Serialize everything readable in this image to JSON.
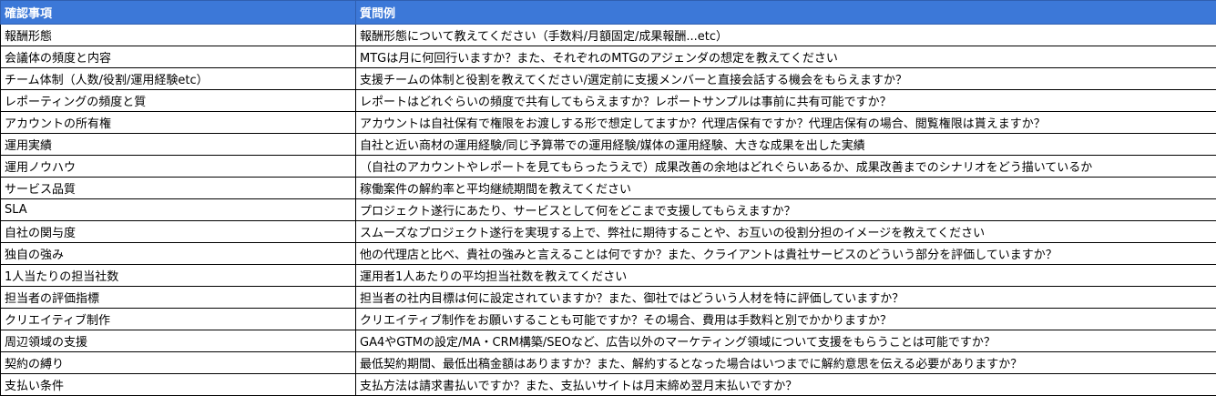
{
  "colors": {
    "header_bg": "#3c78d8",
    "header_text": "#ffffff",
    "border": "#000000"
  },
  "table": {
    "headers": [
      "確認事項",
      "質問例"
    ],
    "rows": [
      [
        "報酬形態",
        "報酬形態について教えてください（手数料/月額固定/成果報酬...etc）"
      ],
      [
        "会議体の頻度と内容",
        "MTGは月に何回行いますか？また、それぞれのMTGのアジェンダの想定を教えてください"
      ],
      [
        "チーム体制（人数/役割/運用経験etc）",
        "支援チームの体制と役割を教えてください/選定前に支援メンバーと直接会話する機会をもらえますか？"
      ],
      [
        "レポーティングの頻度と質",
        "レポートはどれぐらいの頻度で共有してもらえますか？レポートサンプルは事前に共有可能ですか？"
      ],
      [
        "アカウントの所有権",
        "アカウントは自社保有で権限をお渡しする形で想定してますか？代理店保有ですか？代理店保有の場合、閲覧権限は貰えますか？"
      ],
      [
        "運用実績",
        "自社と近い商材の運用経験/同じ予算帯での運用経験/媒体の運用経験、大きな成果を出した実績"
      ],
      [
        "運用ノウハウ",
        "（自社のアカウントやレポートを見てもらったうえで）成果改善の余地はどれぐらいあるか、成果改善までのシナリオをどう描いているか"
      ],
      [
        "サービス品質",
        "稼働案件の解約率と平均継続期間を教えてください"
      ],
      [
        "SLA",
        "プロジェクト遂行にあたり、サービスとして何をどこまで支援してもらえますか？"
      ],
      [
        "自社の関与度",
        "スムーズなプロジェクト遂行を実現する上で、弊社に期待することや、お互いの役割分担のイメージを教えてください"
      ],
      [
        "独自の強み",
        "他の代理店と比べ、貴社の強みと言えることは何ですか？また、クライアントは貴社サービスのどういう部分を評価していますか？"
      ],
      [
        "1人当たりの担当社数",
        "運用者1人あたりの平均担当社数を教えてください"
      ],
      [
        "担当者の評価指標",
        "担当者の社内目標は何に設定されていますか？また、御社ではどういう人材を特に評価していますか？"
      ],
      [
        "クリエイティブ制作",
        "クリエイティブ制作をお願いすることも可能ですか？その場合、費用は手数料と別でかかりますか？"
      ],
      [
        "周辺領域の支援",
        "GA4やGTMの設定/MA・CRM構築/SEOなど、広告以外のマーケティング領域について支援をもらうことは可能ですか？"
      ],
      [
        "契約の縛り",
        "最低契約期間、最低出稿金額はありますか？また、解約するとなった場合はいつまでに解約意思を伝える必要がありますか？"
      ],
      [
        "支払い条件",
        "支払方法は請求書払いですか？また、支払いサイトは月末締め翌月末払いですか？"
      ]
    ]
  }
}
